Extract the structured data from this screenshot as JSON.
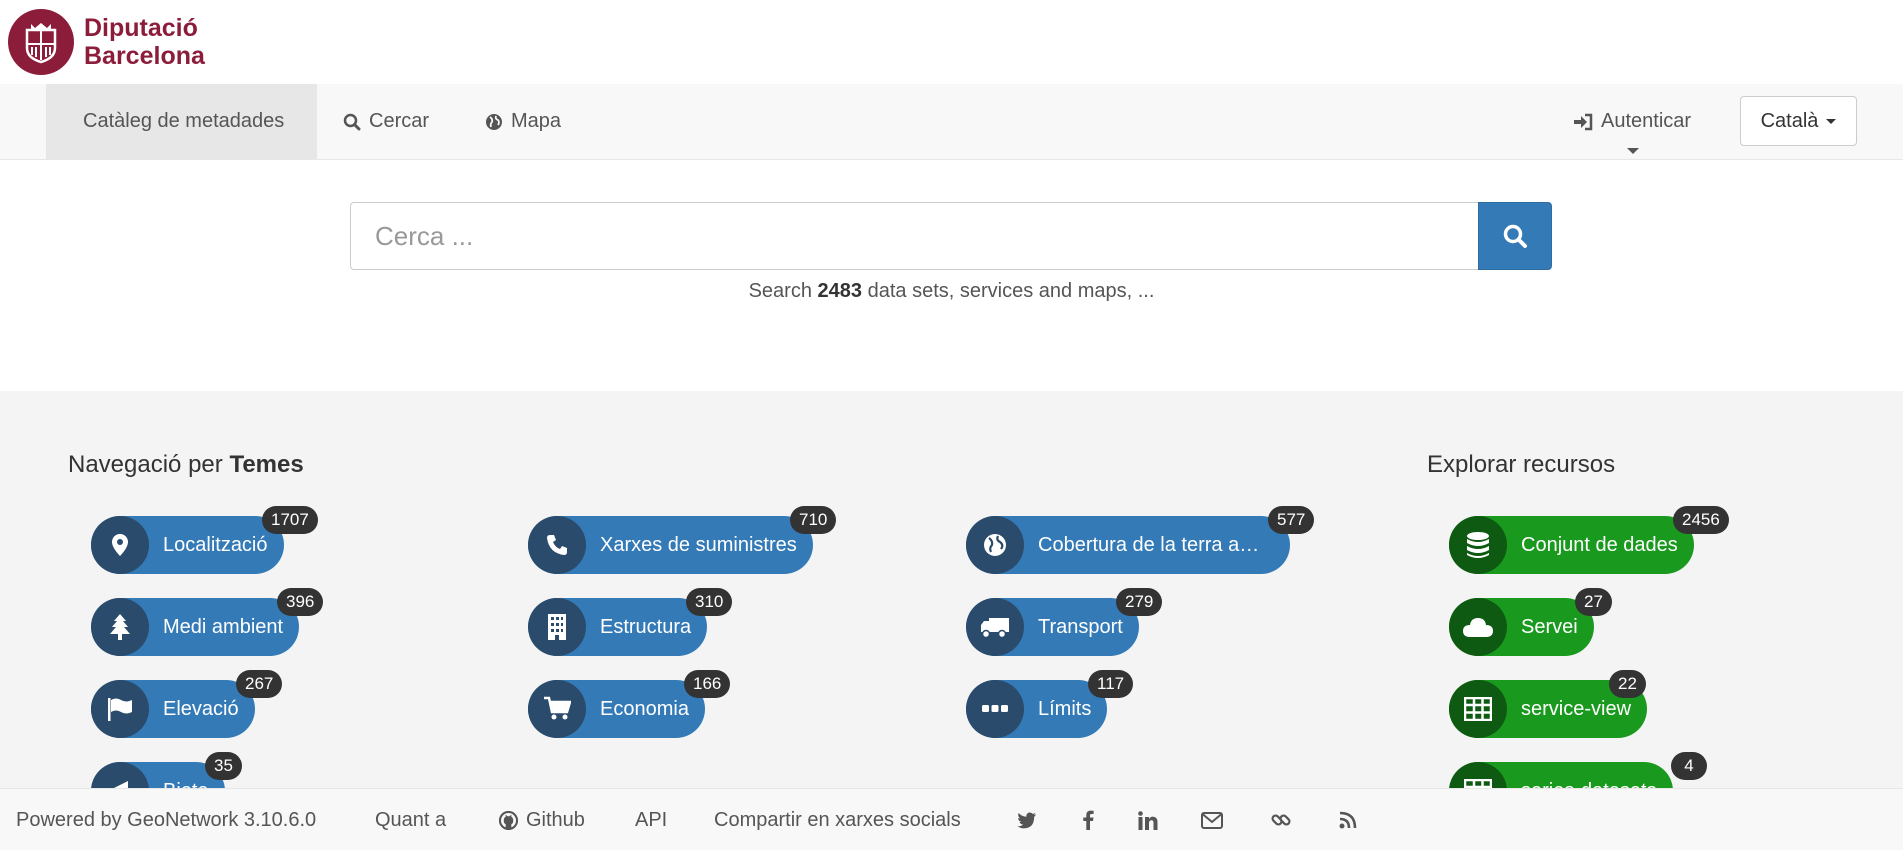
{
  "brand": {
    "line1": "Diputació",
    "line2": "Barcelona",
    "color": "#8c1d3a"
  },
  "nav": {
    "catalog": "Catàleg de metadades",
    "search": "Cercar",
    "map": "Mapa",
    "login": "Autenticar",
    "language": "Català"
  },
  "search": {
    "placeholder": "Cerca ...",
    "hint_prefix": "Search",
    "hint_count": "2483",
    "hint_suffix": "data sets, services and maps, ..."
  },
  "topics": {
    "title_prefix": "Navegació per",
    "title_strong": "Temes",
    "items": [
      {
        "label": "Localització",
        "count": "1707",
        "icon": "map-marker-icon"
      },
      {
        "label": "Xarxes de suministres",
        "count": "710",
        "icon": "phone-icon"
      },
      {
        "label": "Cobertura de la terra amb mapes de base i imatges",
        "count": "577",
        "icon": "globe-icon"
      },
      {
        "label": "Medi ambient",
        "count": "396",
        "icon": "tree-icon"
      },
      {
        "label": "Estructura",
        "count": "310",
        "icon": "building-icon"
      },
      {
        "label": "Transport",
        "count": "279",
        "icon": "truck-icon"
      },
      {
        "label": "Elevació",
        "count": "267",
        "icon": "flag-icon"
      },
      {
        "label": "Economia",
        "count": "166",
        "icon": "cart-icon"
      },
      {
        "label": "Límits",
        "count": "117",
        "icon": "ellipsis-icon"
      },
      {
        "label": "Biota",
        "count": "35",
        "icon": "bullhorn-icon"
      }
    ]
  },
  "resources": {
    "title": "Explorar recursos",
    "items": [
      {
        "label": "Conjunt de dades",
        "count": "2456",
        "icon": "database-icon"
      },
      {
        "label": "Servei",
        "count": "27",
        "icon": "cloud-icon"
      },
      {
        "label": "service-view",
        "count": "22",
        "icon": "table-icon"
      },
      {
        "label": "series-datasets",
        "count": "4",
        "icon": "table-icon"
      }
    ]
  },
  "footer": {
    "powered": "Powered by GeoNetwork 3.10.6.0",
    "about": "Quant a",
    "github": "Github",
    "api": "API",
    "share": "Compartir en xarxes socials"
  },
  "colors": {
    "primary": "#337ab7",
    "topic_icon_bg": "#2a4b6b",
    "resource": "#199a1e",
    "resource_icon_bg": "#0f5a12"
  }
}
